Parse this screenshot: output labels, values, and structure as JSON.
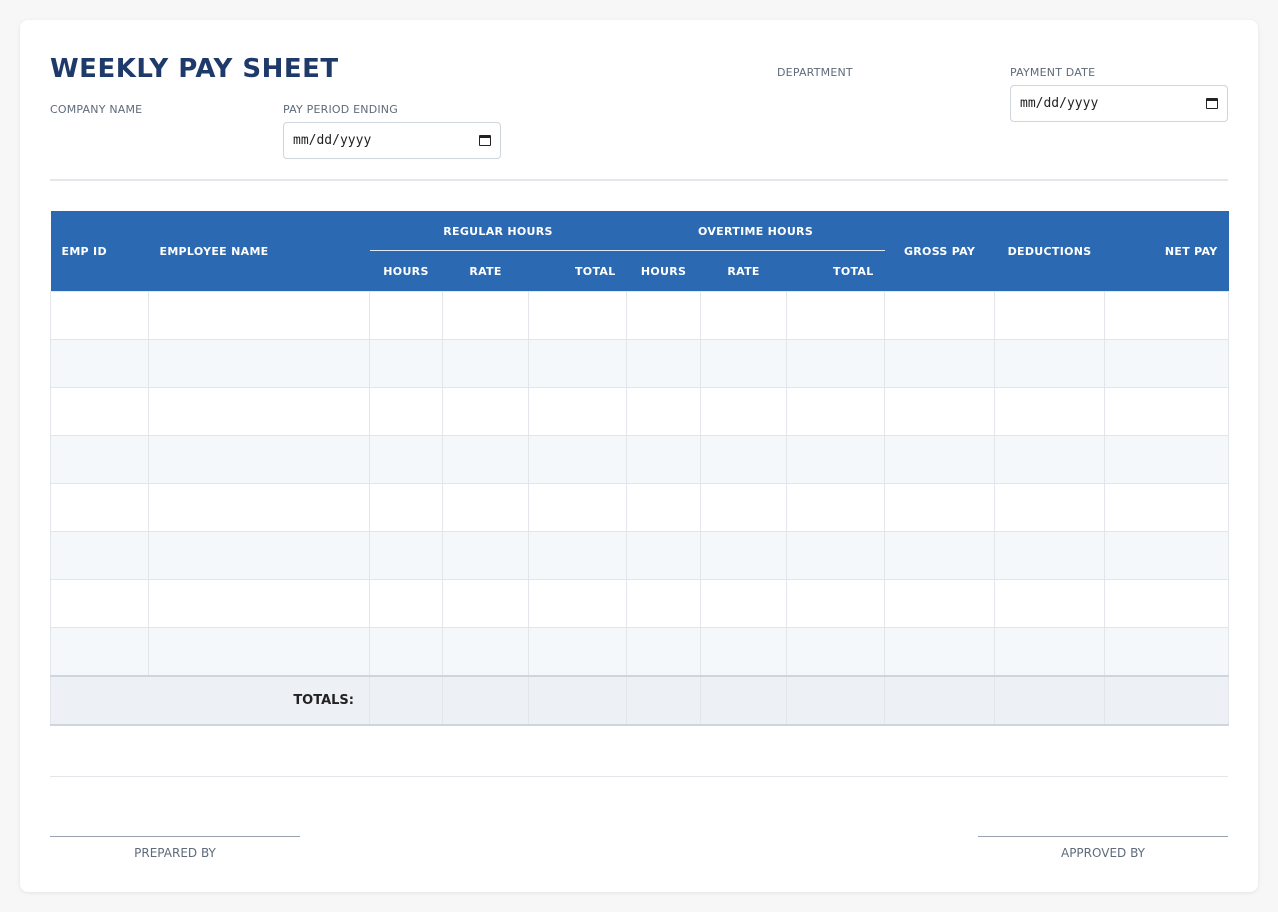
{
  "header": {
    "title": "WEEKLY PAY SHEET",
    "company_label": "COMPANY NAME",
    "pay_period_label": "PAY PERIOD ENDING",
    "pay_period_value": "mm/dd/yyyy",
    "department_label": "DEPARTMENT",
    "payment_date_label": "PAYMENT DATE",
    "payment_date_value": "mm/dd/yyyy"
  },
  "table": {
    "columns": {
      "emp_id": "EMP ID",
      "employee_name": "EMPLOYEE NAME",
      "regular_group": "REGULAR HOURS",
      "overtime_group": "OVERTIME HOURS",
      "gross_pay": "GROSS PAY",
      "deductions": "DEDUCTIONS",
      "net_pay": "NET PAY",
      "reg_hours": "HOURS",
      "reg_rate": "RATE",
      "reg_total": "TOTAL",
      "ot_hours": "HOURS",
      "ot_rate": "RATE",
      "ot_total": "TOTAL"
    },
    "totals_label": "TOTALS:"
  },
  "footer": {
    "prepared_by": "PREPARED BY",
    "approved_by": "APPROVED BY"
  },
  "colors": {
    "title": "#1e3a6b",
    "header_bg": "#2b6ab2",
    "alt_row": "#f5f8fb",
    "totals_bg": "#edf1f5"
  }
}
